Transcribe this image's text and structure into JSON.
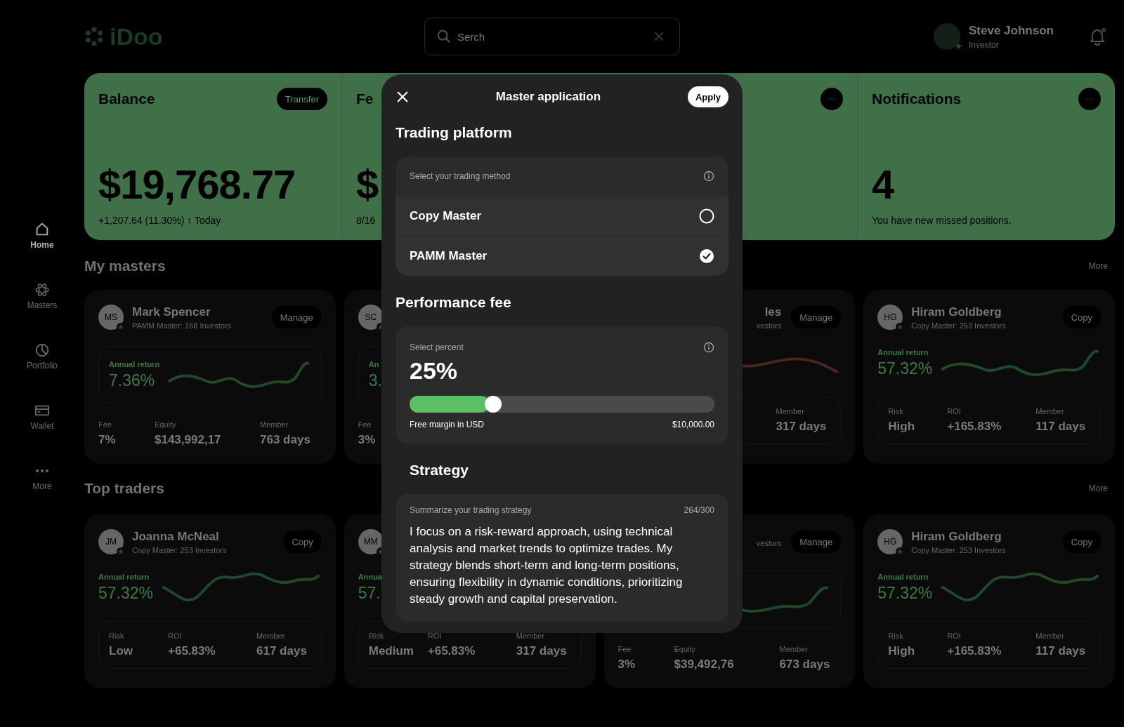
{
  "logo": {
    "text": "iDoo"
  },
  "search": {
    "placeholder": "Serch"
  },
  "user": {
    "name": "Steve Johnson",
    "role": "Investor"
  },
  "notifications": {
    "unread": true
  },
  "sidebar": {
    "items": [
      {
        "label": "Home",
        "selected": true
      },
      {
        "label": "Masters",
        "selected": false
      },
      {
        "label": "Portfolio",
        "selected": false
      },
      {
        "label": "Wallet",
        "selected": false
      },
      {
        "label": "More",
        "selected": false
      }
    ]
  },
  "summary": {
    "panels": [
      {
        "kind": "button",
        "title": "Balance",
        "action": "Transfer",
        "amount": "$19,768.77",
        "note": "+1,207.64 (11.30%) ↑ Today"
      },
      {
        "kind": "plain",
        "title": "Fe",
        "amount": "$",
        "note": "8/16"
      },
      {
        "kind": "menu"
      },
      {
        "kind": "menu",
        "title": "Notifications",
        "amount": "4",
        "note": "You have new missed positions."
      }
    ]
  },
  "sections": [
    {
      "title": "My masters",
      "more": "More",
      "cards": [
        {
          "kind": "master",
          "initials": "MS",
          "name": "Mark Spencer",
          "subtitle": "PAMM Master: 168 Investors",
          "action": "Manage",
          "return_label": "Annual return",
          "return_value": "7.36%",
          "color": "#1f4a2a",
          "stats": [
            {
              "kind": "fee",
              "label": "Fee",
              "value": "7%"
            },
            {
              "kind": "equity",
              "label": "Equity",
              "value": "$143,992,17"
            },
            {
              "kind": "member",
              "label": "Member",
              "value": "763 days"
            }
          ]
        },
        {
          "kind": "master",
          "initials": "SC",
          "return_label": "An",
          "return_value": "3.",
          "stats": [
            {
              "kind": "fee",
              "label": "Fee",
              "value": "3%"
            }
          ]
        },
        {
          "kind": "trader",
          "name": "les",
          "subtitle": "vestors",
          "action": "Manage",
          "color": "#4a2520",
          "stats": [
            {
              "kind": "member",
              "label": "Member",
              "value": "317 days"
            }
          ]
        },
        {
          "kind": "trader",
          "initials": "HG",
          "name": "Hiram Goldberg",
          "subtitle": "Copy Master: 253 Investors",
          "action": "Copy",
          "return_label": "Annual return",
          "return_value": "57.32%",
          "color": "#1f4a2a",
          "stats": [
            {
              "kind": "risk",
              "label": "Risk",
              "value": "High"
            },
            {
              "kind": "roi",
              "label": "ROI",
              "value": "+165.83%"
            },
            {
              "kind": "member",
              "label": "Member",
              "value": "117 days"
            }
          ]
        }
      ]
    },
    {
      "title": "Top traders",
      "more": "More",
      "cards": [
        {
          "kind": "trader",
          "initials": "JM",
          "name": "Joanna McNeal",
          "subtitle": "Copy Master: 253 Investors",
          "action": "Copy",
          "return_label": "Annual return",
          "return_value": "57.32%",
          "color": "#1f4a2a",
          "stats": [
            {
              "kind": "risk",
              "label": "Risk",
              "value": "Low"
            },
            {
              "kind": "roi",
              "label": "ROI",
              "value": "+65.83%"
            },
            {
              "kind": "member",
              "label": "Member",
              "value": "617 days"
            }
          ]
        },
        {
          "kind": "trader",
          "initials": "MM",
          "return_label": "Annua",
          "return_value": "57.",
          "stats": [
            {
              "kind": "risk",
              "label": "Risk",
              "value": "Medium"
            },
            {
              "kind": "roi",
              "label": "ROI",
              "value": "+65.83%"
            },
            {
              "kind": "member",
              "label": "Member",
              "value": "317 days"
            }
          ]
        },
        {
          "kind": "master",
          "subtitle": "vestors",
          "action": "Manage",
          "color": "#1f4a2a",
          "stats": [
            {
              "kind": "fee",
              "label": "Fee",
              "value": "3%"
            },
            {
              "kind": "equity",
              "label": "Equity",
              "value": "$39,492,76"
            },
            {
              "kind": "member",
              "label": "Member",
              "value": "673 days"
            }
          ]
        },
        {
          "kind": "trader",
          "initials": "HG",
          "name": "Hiram Goldberg",
          "subtitle": "Copy Master: 253 Investors",
          "action": "Copy",
          "return_label": "Annual return",
          "return_value": "57.32%",
          "color": "#1f4a2a",
          "stats": [
            {
              "kind": "risk",
              "label": "Risk",
              "value": "High"
            },
            {
              "kind": "roi",
              "label": "ROI",
              "value": "+165.83%"
            },
            {
              "kind": "member",
              "label": "Member",
              "value": "117 days"
            }
          ]
        }
      ]
    }
  ],
  "modal": {
    "title": "Master application",
    "apply": "Apply",
    "platform": {
      "heading": "Trading platform",
      "label": "Select your trading method",
      "options": [
        {
          "label": "Copy Master",
          "selected": false
        },
        {
          "label": "PAMM Master",
          "selected": true
        }
      ]
    },
    "fee": {
      "heading": "Performance fee",
      "label": "Select percent",
      "value": "25%",
      "level": 0.26,
      "footer_label": "Free margin in USD",
      "footer_value": "$10,000.00"
    },
    "strategy": {
      "heading": "Strategy",
      "label": "Summarize your trading strategy",
      "counter": "264/300",
      "text": "I focus on a risk-reward approach, using technical analysis and market trends to optimize trades. My strategy blends short-term and long-term positions, ensuring flexibility in dynamic conditions, prioritizing steady growth and capital preservation."
    }
  }
}
